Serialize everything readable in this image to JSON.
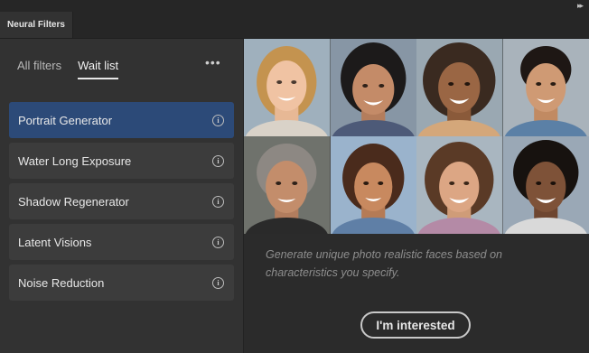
{
  "panel": {
    "tab_label": "Neural Filters",
    "collapse_icon": "double-chevron-right-icon"
  },
  "sidebar": {
    "tabs": [
      {
        "label": "All filters",
        "active": false
      },
      {
        "label": "Wait list",
        "active": true
      }
    ],
    "more_icon": "more-horizontal-icon",
    "filters": [
      {
        "label": "Portrait Generator",
        "selected": true,
        "icon": "info-icon"
      },
      {
        "label": "Water Long Exposure",
        "selected": false,
        "icon": "info-icon"
      },
      {
        "label": "Shadow Regenerator",
        "selected": false,
        "icon": "info-icon"
      },
      {
        "label": "Latent Visions",
        "selected": false,
        "icon": "info-icon"
      },
      {
        "label": "Noise Reduction",
        "selected": false,
        "icon": "info-icon"
      }
    ]
  },
  "preview": {
    "description": "Generate unique photo realistic faces based on characteristics you specify.",
    "button_label": "I'm interested"
  },
  "colors": {
    "accent_selected": "#2c4a78",
    "panel_bg": "#323232"
  }
}
